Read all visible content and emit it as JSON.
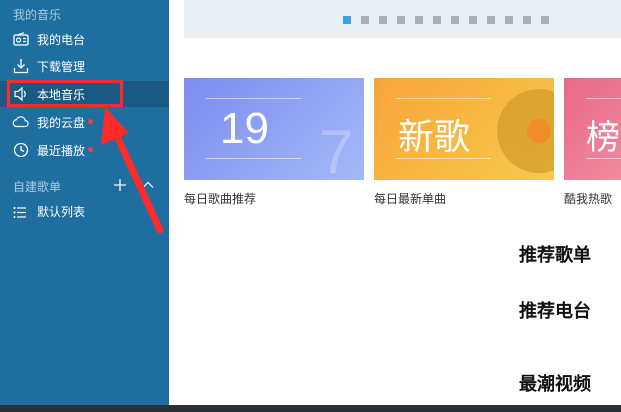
{
  "sidebar": {
    "my_music_title": "我的音乐",
    "items": [
      {
        "label": "我的电台",
        "icon": "radio-icon"
      },
      {
        "label": "下载管理",
        "icon": "download-icon"
      },
      {
        "label": "本地音乐",
        "icon": "speaker-icon"
      },
      {
        "label": "我的云盘",
        "icon": "cloud-icon"
      },
      {
        "label": "最近播放",
        "icon": "clock-icon"
      }
    ],
    "playlists_title": "自建歌单",
    "playlists": [
      {
        "label": "默认列表",
        "icon": "list-icon"
      }
    ]
  },
  "main": {
    "cards": [
      {
        "text": "19",
        "label": "每日歌曲推荐",
        "color_from": "#7c8cf0",
        "color_to": "#a5b8f7"
      },
      {
        "text": "新歌",
        "label": "每日最新单曲",
        "color_from": "#f8a53a",
        "color_to": "#f7c94a"
      },
      {
        "text": "榜",
        "label": "酷我热歌",
        "color_from": "#e8688a",
        "color_to": "#f08a9d"
      }
    ],
    "sections": [
      "推荐歌单",
      "推荐电台",
      "最潮视频"
    ]
  },
  "colors": {
    "sidebar_bg": "#1e6ea0",
    "active_item_bg": "#1a5a82",
    "annotation_red": "#ff2a2a",
    "pager_active": "#3aa3e0"
  }
}
